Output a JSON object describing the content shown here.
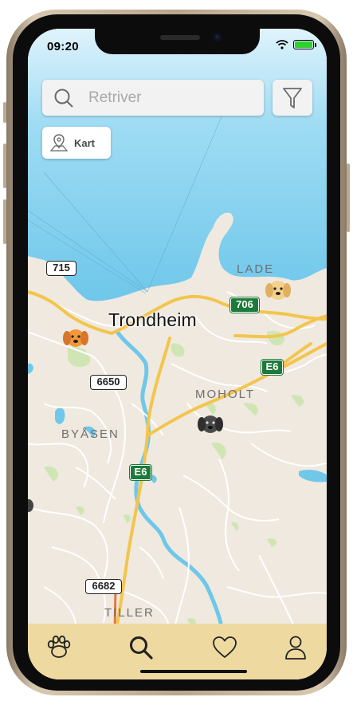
{
  "status": {
    "time": "09:20",
    "battery_level": 1.0
  },
  "search": {
    "value": "",
    "placeholder": "Retriver",
    "icon": "search-icon"
  },
  "filter": {
    "icon": "filter-icon"
  },
  "map_toggle": {
    "label": "Kart",
    "icon": "map-pin-icon"
  },
  "map": {
    "city": "Trondheim",
    "places": [
      "LADE",
      "MOHOLT",
      "BYÅSEN",
      "TILLER"
    ],
    "road_shields": {
      "r715": "715",
      "r706": "706",
      "r6650": "6650",
      "e6a": "E6",
      "e6b": "E6",
      "r6682": "6682"
    },
    "markers": [
      "golden-retriever-marker",
      "orange-dog-marker",
      "black-dog-marker"
    ],
    "colors": {
      "water": "#6fc7ea",
      "land": "#efe9df",
      "park": "#cfe6b4",
      "road_major": "#f3c54d",
      "road_minor": "#ffffff"
    }
  },
  "tabbar": {
    "items": [
      {
        "name": "paw-icon",
        "active": false
      },
      {
        "name": "search-icon",
        "active": true
      },
      {
        "name": "heart-icon",
        "active": false
      },
      {
        "name": "profile-icon",
        "active": false
      }
    ],
    "background": "#eed9a0"
  }
}
